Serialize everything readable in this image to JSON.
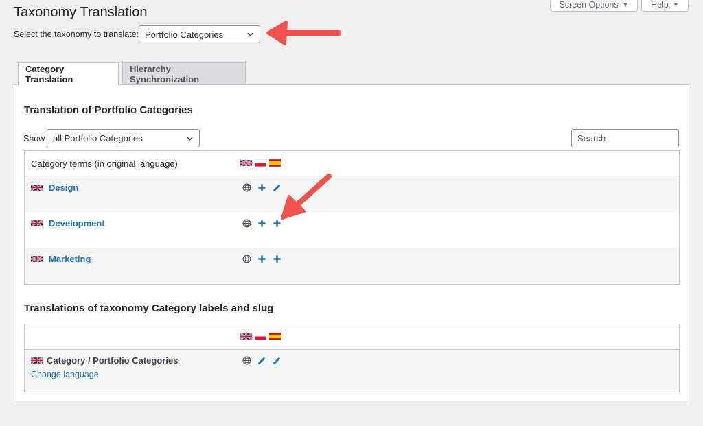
{
  "header": {
    "screen_options": "Screen Options",
    "help": "Help",
    "title": "Taxonomy Translation",
    "select_label": "Select the taxonomy to translate:",
    "taxonomy_value": "Portfolio Categories"
  },
  "tabs": [
    {
      "label": "Category Translation",
      "active": true
    },
    {
      "label": "Hierarchy Synchronization",
      "active": false
    }
  ],
  "terms_section": {
    "title": "Translation of Portfolio Categories",
    "show_label": "Show",
    "show_value": "all Portfolio Categories",
    "search_placeholder": "Search",
    "header_label": "Category terms (in original language)",
    "languages": [
      "en",
      "pl",
      "es"
    ],
    "rows": [
      {
        "name": "Design",
        "actions": [
          "globe-icon",
          "plus-icon",
          "pencil-icon"
        ]
      },
      {
        "name": "Development",
        "actions": [
          "globe-icon",
          "plus-icon",
          "plus-icon"
        ]
      },
      {
        "name": "Marketing",
        "actions": [
          "globe-icon",
          "plus-icon",
          "plus-icon"
        ]
      }
    ]
  },
  "labels_section": {
    "title": "Translations of taxonomy Category labels and slug",
    "row_label": "Category / Portfolio Categories",
    "change_language": "Change language",
    "actions": [
      "globe-icon",
      "pencil-icon",
      "pencil-icon"
    ]
  },
  "colors": {
    "link": "#2271b1",
    "annotation_arrow": "#f0524d",
    "page_bg": "#f0f0f1"
  }
}
